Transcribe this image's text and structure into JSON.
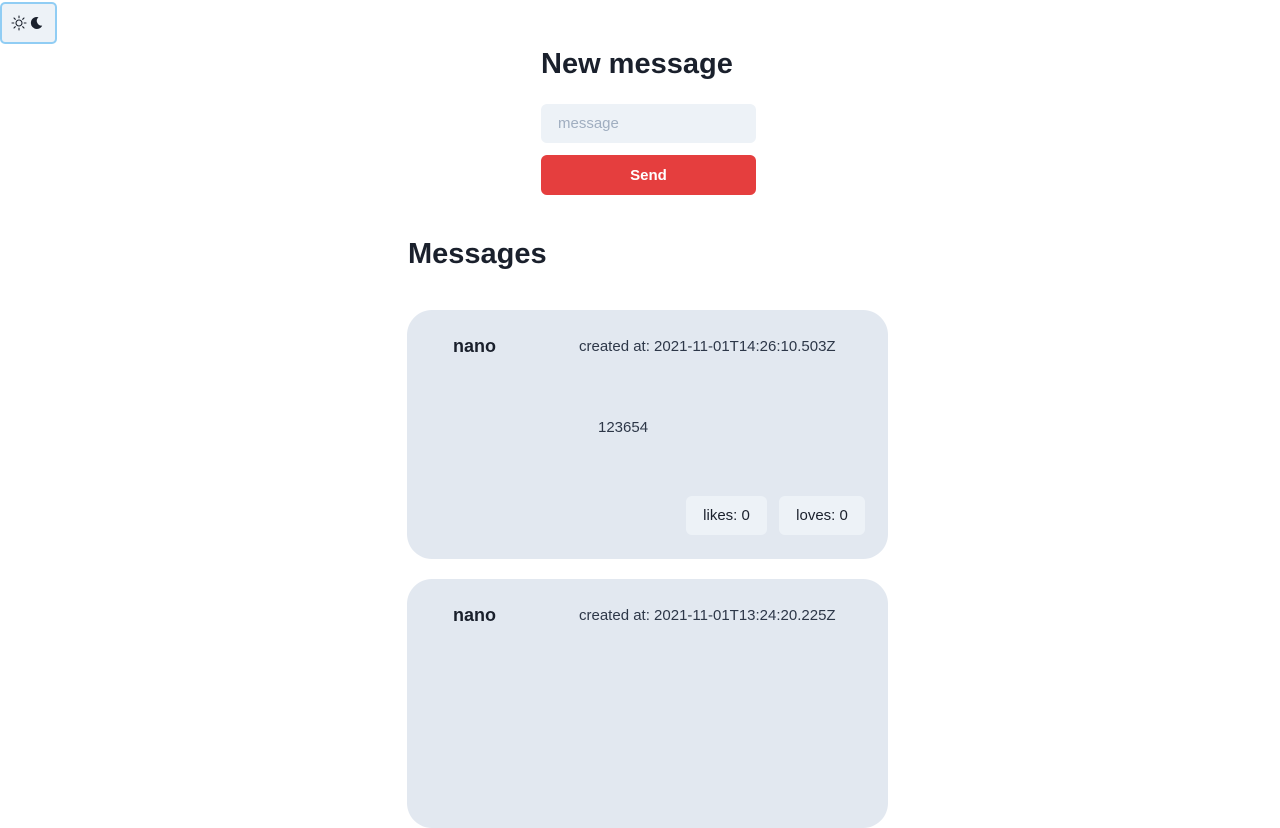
{
  "theme_toggle": {
    "icons": [
      "sun-icon",
      "moon-icon"
    ],
    "border_color": "#90cdf4"
  },
  "new_message": {
    "title": "New message",
    "input_value": "",
    "input_placeholder": "message",
    "send_label": "Send",
    "send_color": "#e53e3e"
  },
  "messages": {
    "title": "Messages",
    "items": [
      {
        "author": "nano",
        "created": "created at: 2021-11-01T14:26:10.503Z",
        "body": "123654",
        "likes_label": "likes: 0",
        "loves_label": "loves: 0"
      },
      {
        "author": "nano",
        "created": "created at: 2021-11-01T13:24:20.225Z"
      }
    ]
  },
  "colors": {
    "card_background": "#e2e8f0",
    "input_background": "#edf2f7",
    "text": "#1a202c"
  }
}
